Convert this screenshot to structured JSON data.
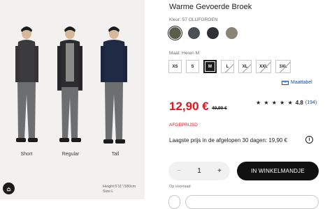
{
  "product": {
    "title": "Warme Gevoerde Broek",
    "color_label": "Kleur: 57 OLIJFGROEN",
    "colors": [
      "#5b5d4b",
      "#4a4f56",
      "#2f3138",
      "#8c8275"
    ],
    "selected_color_index": 0,
    "size_label": "Maat: Heren M",
    "sizes": [
      {
        "label": "XS",
        "state": "available"
      },
      {
        "label": "S",
        "state": "available"
      },
      {
        "label": "M",
        "state": "selected"
      },
      {
        "label": "L",
        "state": "unavailable"
      },
      {
        "label": "XL",
        "state": "unavailable"
      },
      {
        "label": "XXL",
        "state": "unavailable"
      },
      {
        "label": "3XL",
        "state": "unavailable"
      }
    ],
    "size_table_link": "Maattabel",
    "price": "12,90 €",
    "old_price": "49,90 €",
    "rating_stars": "★ ★ ★ ★ ★",
    "rating_score": "4.8",
    "rating_count": "(194)",
    "discount_flag": "AFGEPRIJSD",
    "lowest_price_text": "Laagste prijs in de afgelopen 30 dagen: 19,90 €",
    "info_icon": "i",
    "quantity": "1",
    "minus_symbol": "−",
    "plus_symbol": "+",
    "add_to_cart": "IN WINKELMANDJE",
    "stock": "Op voorraad"
  },
  "image": {
    "models": [
      "Short",
      "Regular",
      "Tall"
    ],
    "note_line1": "Height:5'11\"/180cm",
    "note_line2": "Size:L"
  }
}
